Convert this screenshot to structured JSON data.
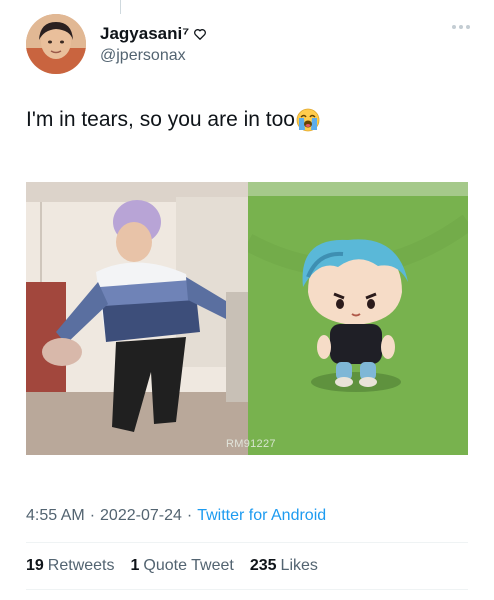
{
  "tweet": {
    "display_name": "Jagyasani⁷",
    "handle": "@jpersonax",
    "text": "I'm in tears, so you are in too",
    "emoji_icon": "loudly-crying-face-icon",
    "verified_heart_icon": "heart-outline-icon",
    "time": "4:55 AM",
    "date": "2022-07-24",
    "source": "Twitter for Android",
    "retweets_count": "19",
    "retweets_label": "Retweets",
    "quotes_count": "1",
    "quotes_label": "Quote Tweet",
    "likes_count": "235",
    "likes_label": "Likes"
  },
  "media": {
    "watermark": "RM91227"
  },
  "colors": {
    "link": "#1d9bf0",
    "secondary_text": "#536471",
    "divider": "#eff3f4"
  }
}
